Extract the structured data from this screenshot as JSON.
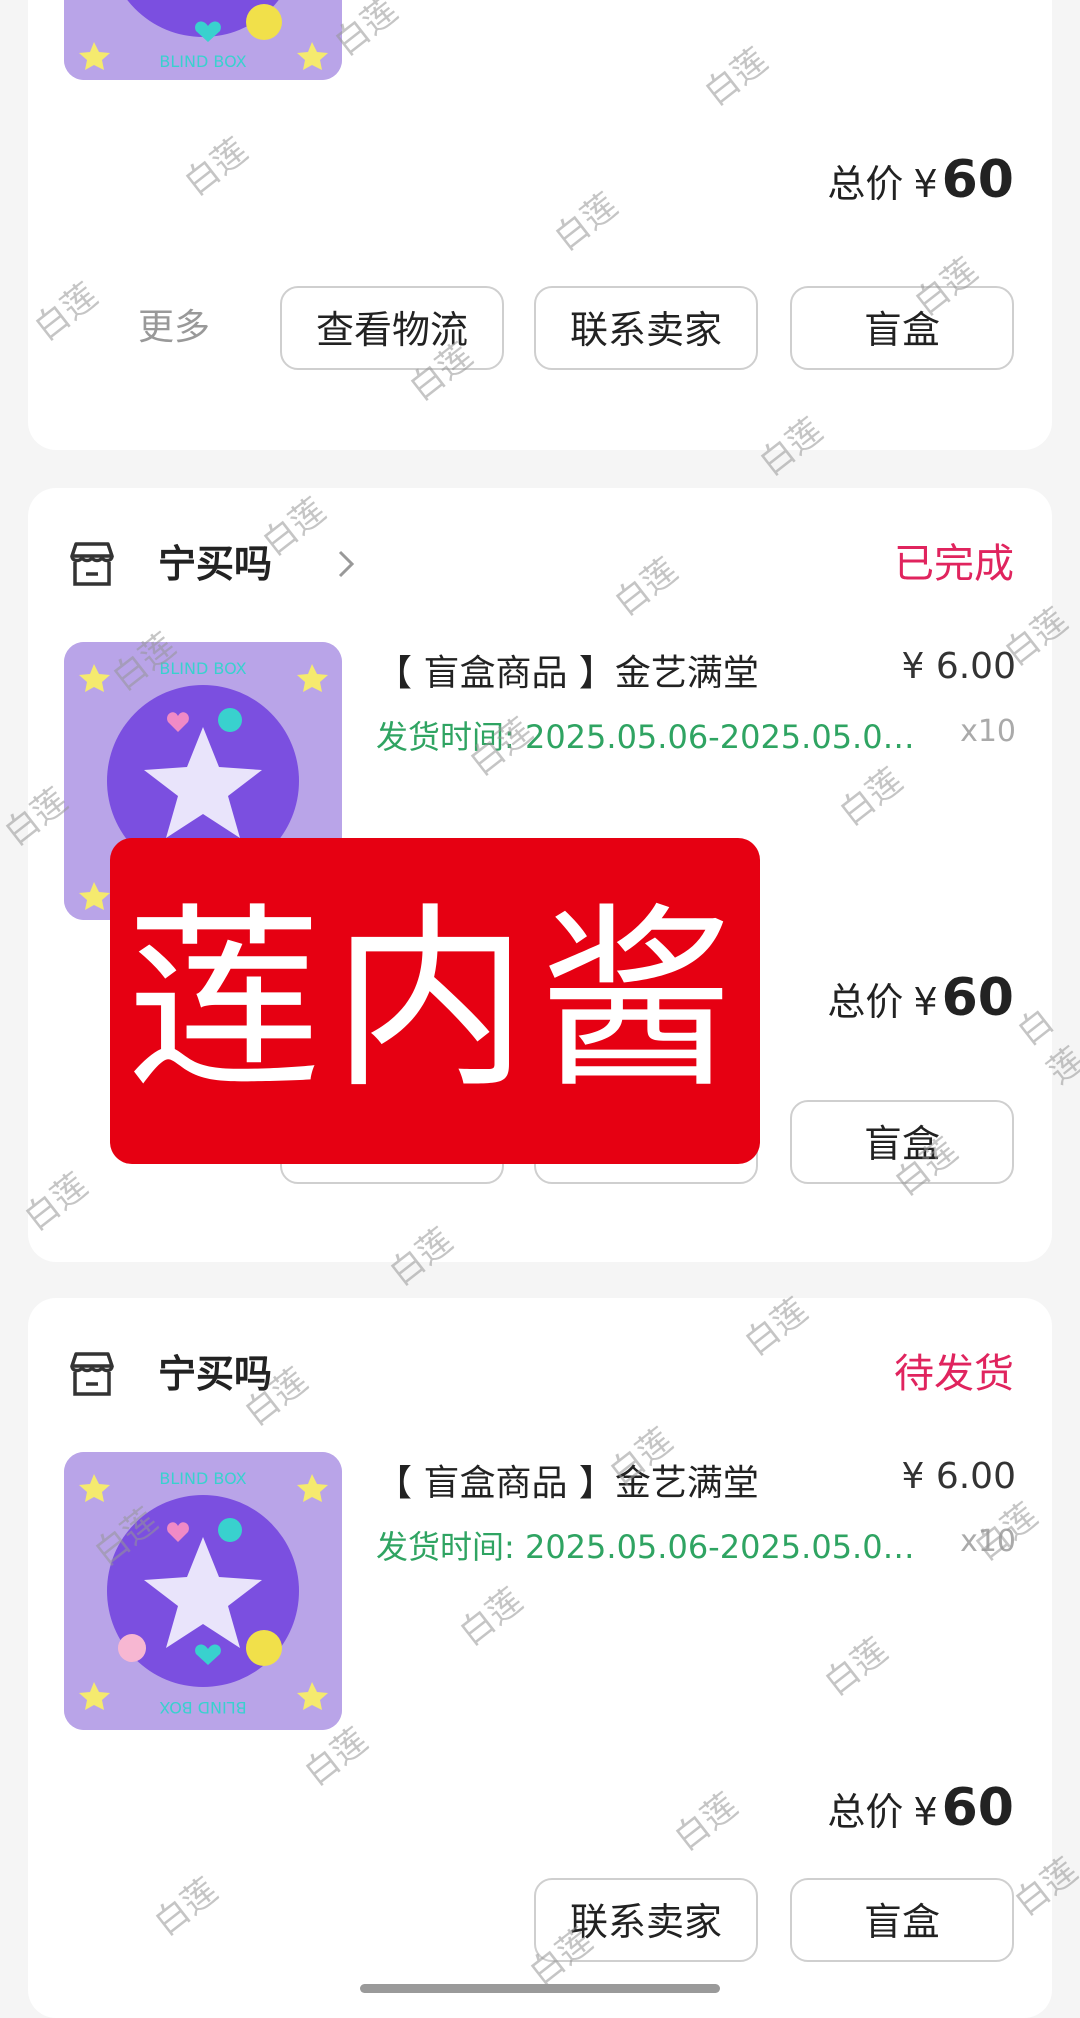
{
  "orders": [
    {
      "shop": "",
      "status": "",
      "total_label": "总价",
      "currency": "¥",
      "total_value": "60",
      "more_label": "更多",
      "buttons": [
        "查看物流",
        "联系卖家",
        "盲盒"
      ]
    },
    {
      "shop": "宁买吗",
      "status": "已完成",
      "product_title": "【 盲盒商品 】金艺满堂",
      "price": "¥ 6.00",
      "ship_time": "发货时间: 2025.05.06-2025.05.0…",
      "qty": "x10",
      "total_label": "总价",
      "currency": "¥",
      "total_value": "60",
      "buttons": [
        "盲盒"
      ]
    },
    {
      "shop": "宁买吗",
      "status": "待发货",
      "product_title": "【 盲盒商品 】金艺满堂",
      "price": "¥ 6.00",
      "ship_time": "发货时间: 2025.05.06-2025.05.0…",
      "qty": "x10",
      "total_label": "总价",
      "currency": "¥",
      "total_value": "60",
      "buttons": [
        "联系卖家",
        "盲盒"
      ]
    }
  ],
  "thumbnail_text": "BLIND BOX",
  "overlay_stamp": "莲内酱",
  "watermark": "白莲",
  "colors": {
    "status": "#e0245e",
    "ship_time": "#2fa462",
    "stamp": "#e60012",
    "thumb_bg": "#b9a4e8"
  }
}
